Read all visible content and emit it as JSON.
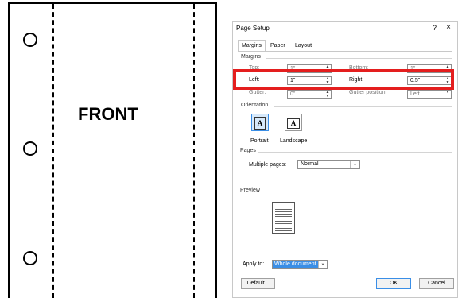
{
  "illustration": {
    "label": "FRONT"
  },
  "dialog": {
    "title": "Page Setup",
    "help": "?",
    "close": "×",
    "tabs": [
      "Margins",
      "Paper",
      "Layout"
    ],
    "margins_section": "Margins",
    "fields": {
      "top": {
        "label": "Top:",
        "value": "1\""
      },
      "bottom": {
        "label": "Bottom:",
        "value": "1\""
      },
      "left": {
        "label": "Left:",
        "value": "1\""
      },
      "right": {
        "label": "Right:",
        "value": "0.5\""
      },
      "gutter": {
        "label": "Gutter:",
        "value": "0\""
      },
      "gutter_position": {
        "label": "Gutter position:",
        "value": "Left"
      }
    },
    "orientation_section": "Orientation",
    "portrait": "Portrait",
    "landscape": "Landscape",
    "pages_section": "Pages",
    "multiple_pages_label": "Multiple pages:",
    "multiple_pages_value": "Normal",
    "preview_section": "Preview",
    "apply_to_label": "Apply to:",
    "apply_to_value": "Whole document",
    "default_button": "Default...",
    "ok_button": "OK",
    "cancel_button": "Cancel",
    "highlight_color": "#e41e1e"
  }
}
